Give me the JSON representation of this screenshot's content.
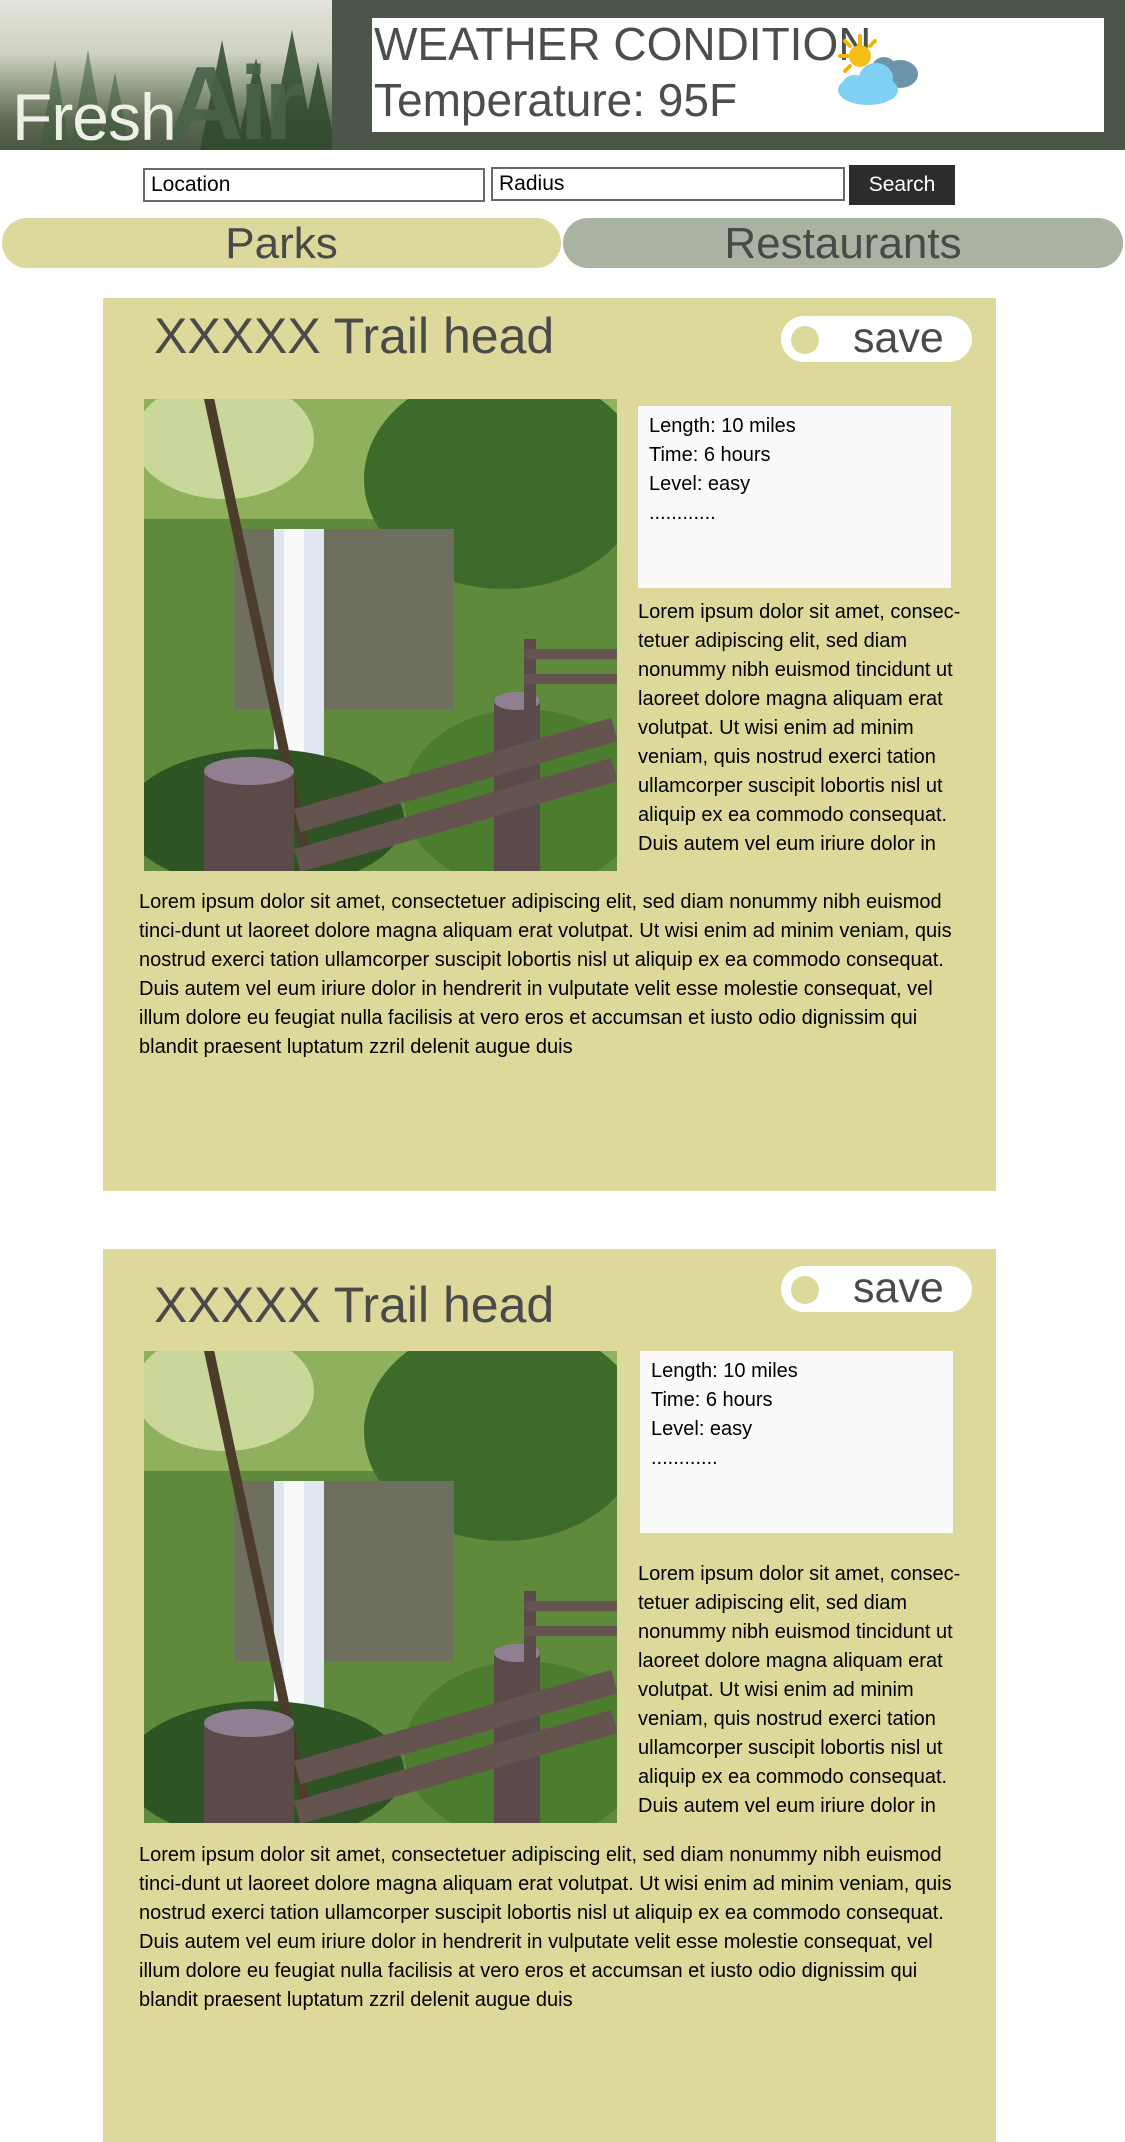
{
  "header": {
    "logo_word": "Fresh",
    "logo_accent": "Air",
    "weather_title": "WEATHER CONDITION",
    "temperature_label": "Temperature:  95F",
    "weather_icon": "partly-cloudy-sun-icon"
  },
  "search": {
    "location_placeholder": "Location",
    "radius_placeholder": "Radius",
    "button_label": "Search"
  },
  "tabs": [
    {
      "label": "Parks"
    },
    {
      "label": "Restaurants"
    }
  ],
  "colors": {
    "header_bg": "#4b5548",
    "card_bg": "#dcd99b",
    "tab_parks": "#dbd99b",
    "tab_restaurants": "#aab3a1",
    "search_button": "#2c2c2a"
  },
  "cards": [
    {
      "title": "XXXXX Trail head",
      "save_label": "save",
      "stats": [
        "Length: 10 miles",
        "Time: 6 hours",
        "Level: easy",
        "............"
      ],
      "side_text": "Lorem ipsum dolor sit amet, consec-tetuer adipiscing elit, sed diam nonummy nibh euismod tincidunt ut laoreet dolore magna aliquam erat volutpat. Ut wisi enim ad minim veniam, quis nostrud exerci tation ullamcorper suscipit lobortis nisl ut aliquip ex ea commodo consequat. Duis autem vel eum iriure dolor in",
      "body_text": "Lorem ipsum dolor sit amet, consectetuer adipiscing elit, sed diam nonummy nibh euismod tinci-dunt ut laoreet dolore magna aliquam erat volutpat. Ut wisi enim ad minim veniam, quis nostrud exerci tation ullamcorper suscipit lobortis nisl ut aliquip ex ea commodo consequat. Duis autem vel eum iriure dolor in hendrerit in vulputate velit esse molestie consequat, vel illum dolore eu feugiat nulla facilisis at vero eros et accumsan et iusto odio dignissim qui blandit praesent luptatum zzril delenit augue duis"
    },
    {
      "title": "XXXXX Trail head",
      "save_label": "save",
      "stats": [
        "Length: 10 miles",
        "Time: 6 hours",
        "Level: easy",
        "............"
      ],
      "side_text": "Lorem ipsum dolor sit amet, consec-tetuer adipiscing elit, sed diam nonummy nibh euismod tincidunt ut laoreet dolore magna aliquam erat volutpat. Ut wisi enim ad minim veniam, quis nostrud exerci tation ullamcorper suscipit lobortis nisl ut aliquip ex ea commodo consequat. Duis autem vel eum iriure dolor in",
      "body_text": "Lorem ipsum dolor sit amet, consectetuer adipiscing elit, sed diam nonummy nibh euismod tinci-dunt ut laoreet dolore magna aliquam erat volutpat. Ut wisi enim ad minim veniam, quis nostrud exerci tation ullamcorper suscipit lobortis nisl ut aliquip ex ea commodo consequat. Duis autem vel eum iriure dolor in hendrerit in vulputate velit esse molestie consequat, vel illum dolore eu feugiat nulla facilisis at vero eros et accumsan et iusto odio dignissim qui blandit praesent luptatum zzril delenit augue duis"
    }
  ]
}
